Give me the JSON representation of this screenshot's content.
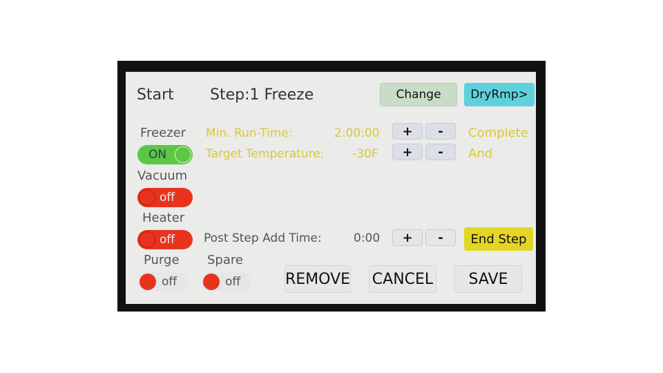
{
  "header": {
    "start_label": "Start",
    "step_title": "Step:1 Freeze",
    "change_button": "Change",
    "next_button": "DryRmp>"
  },
  "toggles": [
    {
      "label": "Freezer",
      "state": "ON"
    },
    {
      "label": "Vacuum",
      "state": "off"
    },
    {
      "label": "Heater",
      "state": "off"
    },
    {
      "label": "Purge",
      "state": "off"
    },
    {
      "label": "Spare",
      "state": "off"
    }
  ],
  "params": {
    "min_run_time": {
      "label": "Min. Run-Time:",
      "value": "2:00:00"
    },
    "target_temp": {
      "label": "Target Temperature:",
      "value": "-30F"
    },
    "condition_1": "Complete",
    "condition_2": "And",
    "post_step": {
      "label": "Post Step Add Time:",
      "value": "0:00"
    },
    "plus": "+",
    "minus": "-"
  },
  "buttons": {
    "end_step": "End Step",
    "remove": "REMOVE",
    "cancel": "CANCEL",
    "save": "SAVE"
  },
  "colors": {
    "on": "#5cc745",
    "off": "#e8341e",
    "change": "#c9dcc8",
    "next": "#5fd1dc",
    "end_step": "#e3d524",
    "param_text": "#d8c838"
  }
}
